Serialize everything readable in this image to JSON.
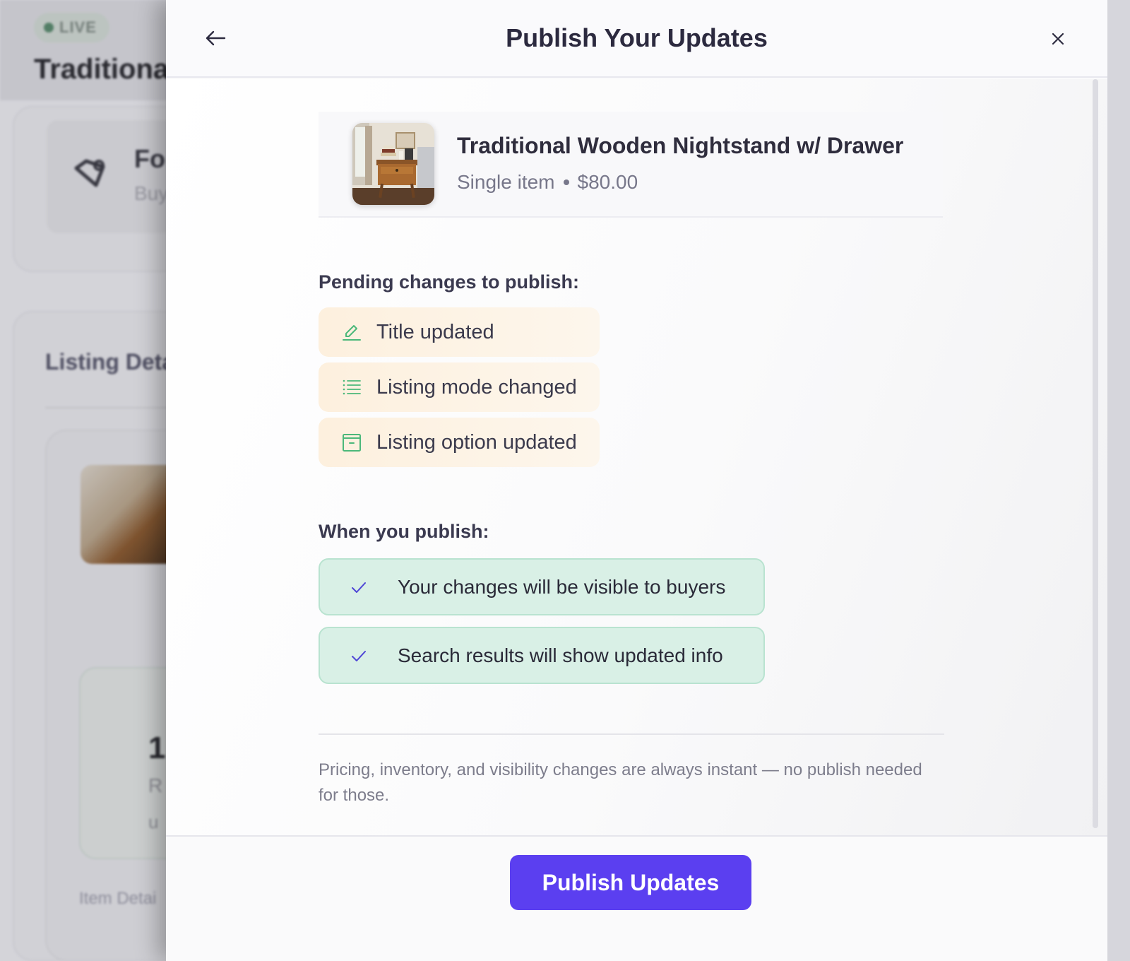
{
  "background": {
    "live_badge": "LIVE",
    "page_title": "Traditiona",
    "card_heading": "Fo",
    "card_subtext": "Buy",
    "listing_heading": "Listing Deta",
    "stat_value": "1",
    "stat_label": "R",
    "stat_sub": "u",
    "item_label": "Item Detai"
  },
  "modal": {
    "title": "Publish Your Updates",
    "back_icon": "arrow-left-icon",
    "close_icon": "close-icon"
  },
  "product": {
    "name": "Traditional Wooden Nightstand w/ Drawer",
    "mode": "Single item",
    "price": "$80.00"
  },
  "pending": {
    "heading": "Pending changes to publish:",
    "items": [
      {
        "label": "Title updated",
        "icon": "pencil-icon"
      },
      {
        "label": "Listing mode changed",
        "icon": "list-icon"
      },
      {
        "label": "Listing option updated",
        "icon": "option-box-icon"
      }
    ]
  },
  "on_publish": {
    "heading": "When you publish:",
    "items": [
      {
        "label": "Your changes will be visible to buyers",
        "icon": "check-icon"
      },
      {
        "label": "Search results will show updated info",
        "icon": "check-icon"
      }
    ]
  },
  "footnote": "Pricing, inventory, and visibility changes are always instant — no publish needed for those.",
  "footer": {
    "publish_label": "Publish Updates"
  },
  "colors": {
    "accent": "#5b3ff0",
    "pending_bg": "#fdf0de",
    "benefit_bg": "#d9f0e6",
    "icon_green": "#4cb87a"
  }
}
